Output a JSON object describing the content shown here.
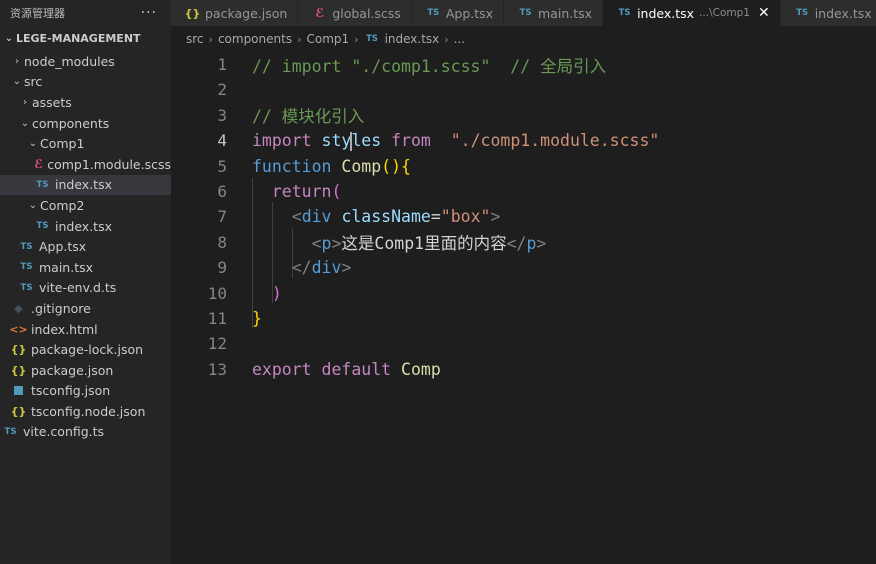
{
  "sidebar": {
    "title": "资源管理器",
    "more": "···",
    "root": "LEGE-MANAGEMENT",
    "items": [
      {
        "label": "node_modules",
        "chev": "›",
        "icon": "",
        "indent": 1
      },
      {
        "label": "src",
        "chev": "⌄",
        "icon": "",
        "indent": 1
      },
      {
        "label": "assets",
        "chev": "›",
        "icon": "",
        "indent": 2
      },
      {
        "label": "components",
        "chev": "⌄",
        "icon": "",
        "indent": 2
      },
      {
        "label": "Comp1",
        "chev": "⌄",
        "icon": "",
        "indent": 3
      },
      {
        "label": "comp1.module.scss",
        "chev": "",
        "icon": "scss",
        "indent": 4
      },
      {
        "label": "index.tsx",
        "chev": "",
        "icon": "ts",
        "indent": 4,
        "selected": true
      },
      {
        "label": "Comp2",
        "chev": "⌄",
        "icon": "",
        "indent": 3
      },
      {
        "label": "index.tsx",
        "chev": "",
        "icon": "ts",
        "indent": 4
      },
      {
        "label": "App.tsx",
        "chev": "",
        "icon": "ts",
        "indent": 2
      },
      {
        "label": "main.tsx",
        "chev": "",
        "icon": "ts",
        "indent": 2
      },
      {
        "label": "vite-env.d.ts",
        "chev": "",
        "icon": "ts",
        "indent": 2
      },
      {
        "label": ".gitignore",
        "chev": "",
        "icon": "git",
        "indent": 1
      },
      {
        "label": "index.html",
        "chev": "",
        "icon": "html",
        "indent": 1
      },
      {
        "label": "package-lock.json",
        "chev": "",
        "icon": "json",
        "indent": 1
      },
      {
        "label": "package.json",
        "chev": "",
        "icon": "json",
        "indent": 1
      },
      {
        "label": "tsconfig.json",
        "chev": "",
        "icon": "tsconfig",
        "indent": 1
      },
      {
        "label": "tsconfig.node.json",
        "chev": "",
        "icon": "json",
        "indent": 1
      },
      {
        "label": "vite.config.ts",
        "chev": "",
        "icon": "ts",
        "indent": 0
      }
    ]
  },
  "icons": {
    "ts": "TS",
    "json": "{}",
    "html": "<>",
    "git": "◆",
    "scss": "ℰ"
  },
  "tabs": [
    {
      "label": "package.json",
      "icon": "json",
      "active": false
    },
    {
      "label": "global.scss",
      "icon": "scss",
      "active": false
    },
    {
      "label": "App.tsx",
      "icon": "ts",
      "active": false
    },
    {
      "label": "main.tsx",
      "icon": "ts",
      "active": false
    },
    {
      "label": "index.tsx",
      "icon": "ts",
      "active": true,
      "path": "...\\Comp1",
      "close": "✕"
    },
    {
      "label": "index.tsx",
      "icon": "ts",
      "active": false
    }
  ],
  "breadcrumb": {
    "parts": [
      "src",
      "components",
      "Comp1"
    ],
    "file_icon": "TS",
    "file": "index.tsx",
    "trailing": "..."
  },
  "editor": {
    "active_line": 4,
    "lines": [
      {
        "n": "1",
        "tokens": [
          [
            "c",
            "// import \"./comp1.scss\"  // 全局引入"
          ]
        ]
      },
      {
        "n": "2",
        "tokens": []
      },
      {
        "n": "3",
        "tokens": [
          [
            "c",
            "// 模块化引入"
          ]
        ]
      },
      {
        "n": "4",
        "tokens": [
          [
            "k",
            "import"
          ],
          [
            "p",
            " "
          ],
          [
            "v",
            "sty"
          ],
          [
            "cursor",
            ""
          ],
          [
            "v",
            "les"
          ],
          [
            "p",
            " "
          ],
          [
            "k",
            "from"
          ],
          [
            "p",
            "  "
          ],
          [
            "s",
            "\"./comp1.module.scss\""
          ]
        ]
      },
      {
        "n": "5",
        "tokens": [
          [
            "f",
            "function"
          ],
          [
            "p",
            " "
          ],
          [
            "fn",
            "Comp"
          ],
          [
            "b1",
            "()"
          ],
          [
            "b1",
            "{"
          ]
        ]
      },
      {
        "n": "6",
        "tokens": [
          [
            "p",
            "  "
          ],
          [
            "k",
            "return"
          ],
          [
            "b2",
            "("
          ]
        ]
      },
      {
        "n": "7",
        "tokens": [
          [
            "p",
            "    "
          ],
          [
            "g",
            "<"
          ],
          [
            "t",
            "div"
          ],
          [
            "p",
            " "
          ],
          [
            "a",
            "className"
          ],
          [
            "p",
            "="
          ],
          [
            "s",
            "\"box\""
          ],
          [
            "g",
            ">"
          ]
        ]
      },
      {
        "n": "8",
        "tokens": [
          [
            "p",
            "      "
          ],
          [
            "g",
            "<"
          ],
          [
            "t",
            "p"
          ],
          [
            "g",
            ">"
          ],
          [
            "p",
            "这是Comp1里面的内容"
          ],
          [
            "g",
            "</"
          ],
          [
            "t",
            "p"
          ],
          [
            "g",
            ">"
          ]
        ]
      },
      {
        "n": "9",
        "tokens": [
          [
            "p",
            "    "
          ],
          [
            "g",
            "</"
          ],
          [
            "t",
            "div"
          ],
          [
            "g",
            ">"
          ]
        ]
      },
      {
        "n": "10",
        "tokens": [
          [
            "p",
            "  "
          ],
          [
            "b2",
            ")"
          ]
        ]
      },
      {
        "n": "11",
        "tokens": [
          [
            "b1",
            "}"
          ]
        ]
      },
      {
        "n": "12",
        "tokens": []
      },
      {
        "n": "13",
        "tokens": [
          [
            "k",
            "export"
          ],
          [
            "p",
            " "
          ],
          [
            "k",
            "default"
          ],
          [
            "p",
            " "
          ],
          [
            "fn",
            "Comp"
          ]
        ]
      }
    ]
  }
}
